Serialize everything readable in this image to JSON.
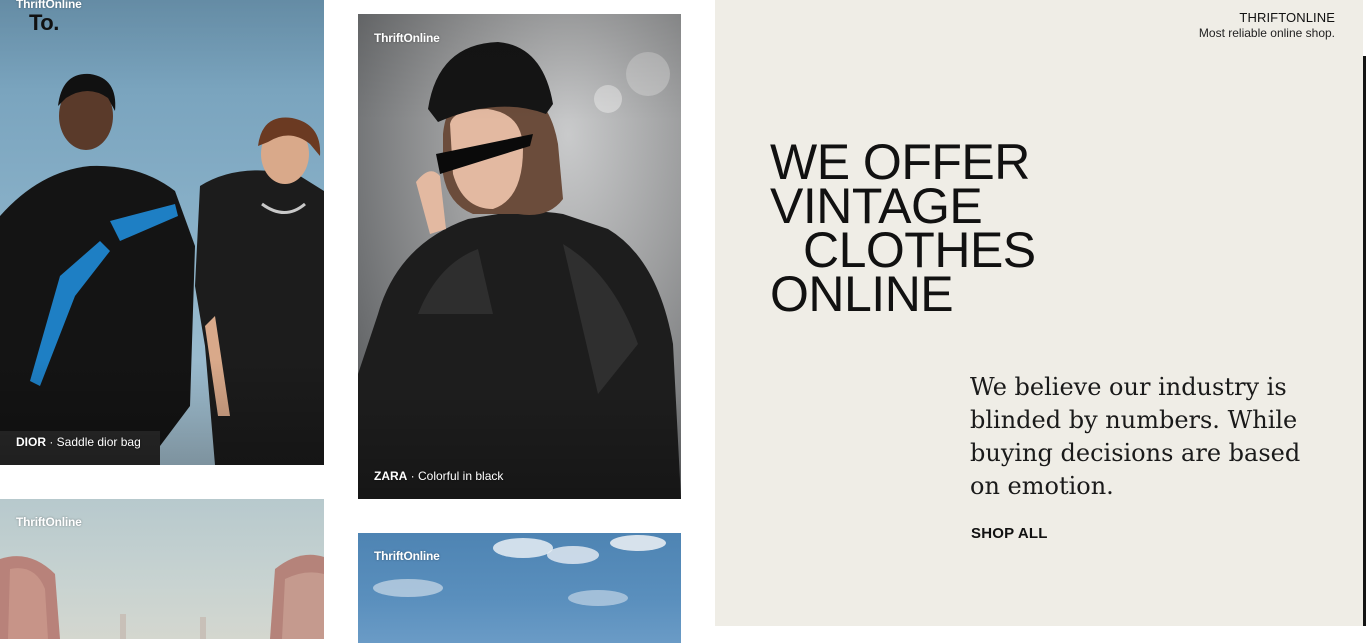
{
  "cards": [
    {
      "brand": "ThriftOnline",
      "caption_brand": "DIOR",
      "caption_sep": " · ",
      "caption_text": "Saddle dior bag"
    },
    {
      "brand": "ThriftOnline",
      "caption_brand": "ZARA",
      "caption_sep": " · ",
      "caption_text": "Colorful in black"
    },
    {
      "brand": "ThriftOnline"
    },
    {
      "brand": "ThriftOnline"
    }
  ],
  "logo": "To.",
  "hero": {
    "brand_name": "THRIFTONLINE",
    "tagline": "Most reliable online shop.",
    "headline_lines": [
      "WE OFFER",
      "VINTAGE",
      "CLOTHES",
      "ONLINE"
    ],
    "body": "We believe our industry is blinded by numbers. While buying decisions are based on emotion.",
    "cta": "SHOP ALL"
  },
  "colors": {
    "hero_background": "#efede6",
    "text": "#111111"
  }
}
